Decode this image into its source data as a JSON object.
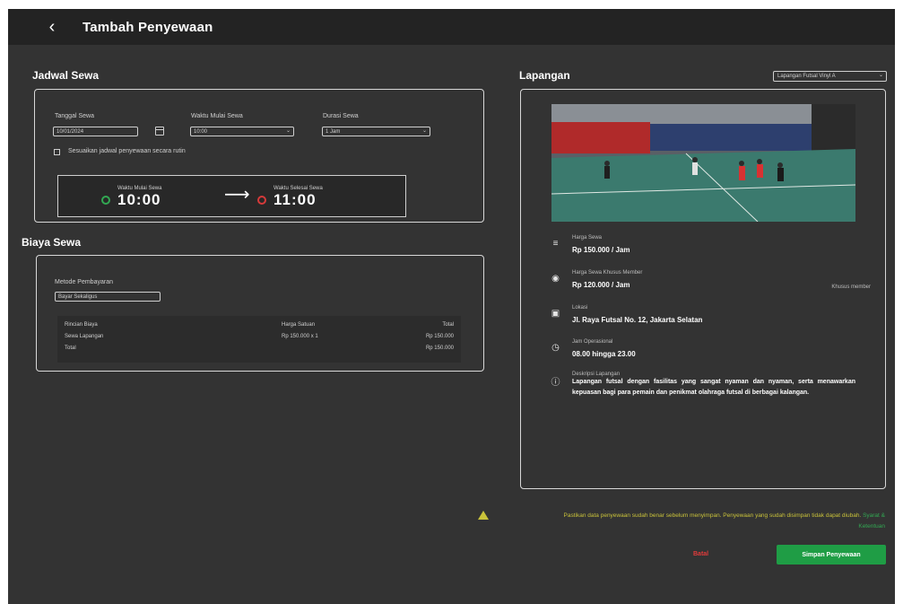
{
  "header": {
    "title": "Tambah Penyewaan"
  },
  "jadwal": {
    "title": "Jadwal Sewa",
    "tanggal_label": "Tanggal Sewa",
    "tanggal_value": "10/01/2024",
    "mulai_label": "Waktu Mulai Sewa",
    "mulai_value": "10:00",
    "durasi_label": "Durasi Sewa",
    "durasi_value": "1 Jam",
    "checkbox_label": "Sesuaikan jadwal penyewaan secara rutin",
    "start_caption": "Waktu Mulai Sewa",
    "start_time": "10:00",
    "end_caption": "Waktu Selesai Sewa",
    "end_time": "11:00"
  },
  "biaya": {
    "title": "Biaya Sewa",
    "metode_label": "Metode Pembayaran",
    "metode_value": "Bayar Sekaligus",
    "table_headers": [
      "Rincian Biaya",
      "Harga Satuan",
      "Total"
    ],
    "rows": [
      [
        "Sewa Lapangan",
        "Rp 150.000 x 1",
        "Rp 150.000"
      ],
      [
        "Total",
        "",
        "Rp 150.000"
      ]
    ]
  },
  "lapangan": {
    "title": "Lapangan",
    "select_value": "Lapangan Futsal Vinyl A",
    "harga_label": "Harga Sewa",
    "harga_value": "Rp 150.000 / Jam",
    "harga_member_label": "Harga Sewa Khusus Member",
    "harga_member_value": "Rp 120.000 / Jam",
    "harga_member_note": "Khusus member",
    "lokasi_label": "Lokasi",
    "lokasi_value": "Jl. Raya Futsal No. 12, Jakarta Selatan",
    "jam_label": "Jam Operasional",
    "jam_value": "08.00 hingga 23.00",
    "deskripsi_label": "Deskripsi Lapangan",
    "deskripsi_value": "Lapangan futsal dengan fasilitas yang sangat nyaman dan nyaman, serta menawarkan kepuasan bagi para pemain dan penikmat olahraga futsal di berbagai kalangan."
  },
  "footer": {
    "warning_text": "Pastikan data penyewaan sudah benar sebelum menyimpan. Penyewaan yang sudah disimpan tidak dapat diubah.",
    "warning_link": "Syarat & Ketentuan",
    "cancel_label": "Batal",
    "submit_label": "Simpan Penyewaan"
  },
  "colors": {
    "accent_green": "#1f9d45",
    "danger_red": "#e23b3b",
    "warning_yellow": "#c9c23a",
    "background": "#333333",
    "header": "#232323"
  },
  "icons": [
    "back-arrow-icon",
    "calendar-icon",
    "checkbox-icon",
    "clock-green-icon",
    "arrow-right-icon",
    "clock-red-icon",
    "chevron-down-icon",
    "money-icon",
    "member-icon",
    "location-icon",
    "clock-icon",
    "info-icon",
    "warning-icon"
  ]
}
